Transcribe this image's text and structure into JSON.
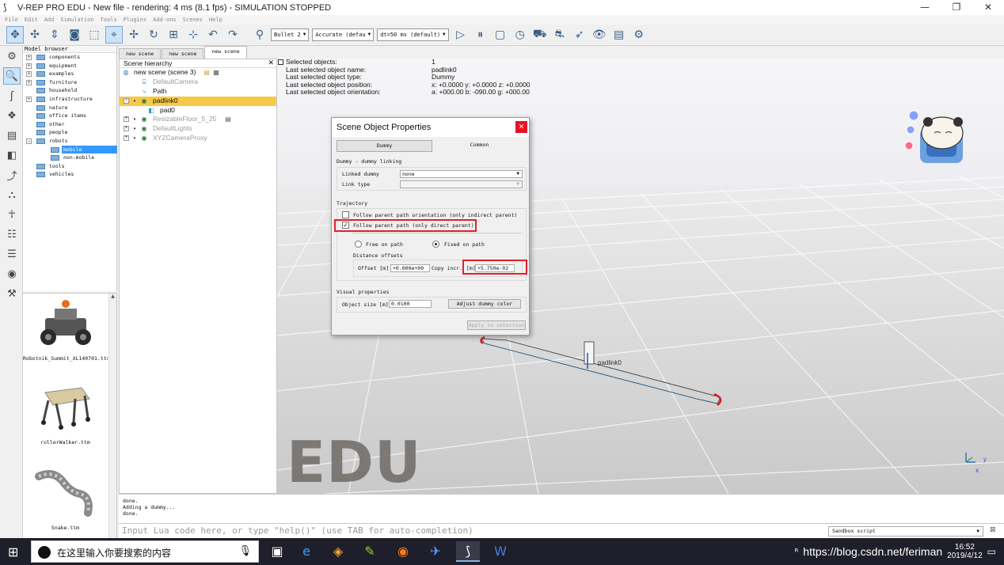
{
  "window": {
    "title": "V-REP PRO EDU - New file - rendering: 4 ms (8.1 fps) - SIMULATION STOPPED",
    "minimize": "—",
    "maximize": "❐",
    "close": "✕"
  },
  "menu": [
    "File",
    "Edit",
    "Add",
    "Simulation",
    "Tools",
    "Plugins",
    "Add-ons",
    "Scenes",
    "Help"
  ],
  "toolbar": {
    "engine": "Bullet 2",
    "accuracy": "Accurate (defau",
    "timestep": "dt=50 ms (default)"
  },
  "model_browser": {
    "header": "Model browser",
    "items": [
      {
        "label": "components",
        "expandable": true
      },
      {
        "label": "equipment",
        "expandable": true
      },
      {
        "label": "examples",
        "expandable": true
      },
      {
        "label": "furniture",
        "expandable": true
      },
      {
        "label": "household",
        "expandable": false
      },
      {
        "label": "infrastructure",
        "expandable": true
      },
      {
        "label": "nature",
        "expandable": false
      },
      {
        "label": "office items",
        "expandable": false
      },
      {
        "label": "other",
        "expandable": false
      },
      {
        "label": "people",
        "expandable": false
      },
      {
        "label": "robots",
        "expandable": true
      },
      {
        "label": "mobile",
        "expandable": false
      },
      {
        "label": "non-mobile",
        "expandable": false
      },
      {
        "label": "tools",
        "expandable": false
      },
      {
        "label": "vehicles",
        "expandable": false
      }
    ],
    "thumbnails": [
      {
        "caption": "Robotnik_Summit_XL140701.ttm"
      },
      {
        "caption": "rollerWalker.ttm"
      },
      {
        "caption": "Snake.ttm"
      }
    ]
  },
  "scene_tabs": [
    "new scene",
    "new scene",
    "new scene"
  ],
  "hierarchy": {
    "header": "Scene hierarchy",
    "items": [
      {
        "label": "new scene (scene 3)"
      },
      {
        "label": "DefaultCamera"
      },
      {
        "label": "Path"
      },
      {
        "label": "padlink0"
      },
      {
        "label": "pad0"
      },
      {
        "label": "ResizableFloor_5_25"
      },
      {
        "label": "DefaultLights"
      },
      {
        "label": "XYZCameraProxy"
      }
    ]
  },
  "selection_info": {
    "rows": [
      {
        "k": "Selected objects:",
        "v": "1"
      },
      {
        "k": "Last selected object name:",
        "v": "padlink0"
      },
      {
        "k": "Last selected object type:",
        "v": "Dummy"
      },
      {
        "k": "Last selected object position:",
        "v": "x: +0.0000   y: +0.0000   z: +0.0000"
      },
      {
        "k": "Last selected object orientation:",
        "v": "a: +000.00   b: -090.00   g: +000.00"
      }
    ]
  },
  "viewport": {
    "watermark": "EDU",
    "object_label": "padlink0",
    "axes_y": "y",
    "axes_x": "x"
  },
  "dialog": {
    "title": "Scene Object Properties",
    "close": "✕",
    "tabs": [
      "Dummy",
      "Common"
    ],
    "section_linking": "Dummy - dummy linking",
    "linked_dummy_label": "Linked dummy",
    "linked_dummy_value": "none",
    "link_type_label": "Link type",
    "link_type_value": "",
    "section_trajectory": "Trajectory",
    "follow_orientation": "Follow parent path orientation (only indirect parent)",
    "follow_path": "Follow parent path (only direct parent)",
    "follow_path_checked": "✓",
    "free_on_path": "Free on path",
    "fixed_on_path": "Fixed on path",
    "distance_offsets": "Distance offsets",
    "offset_label": "Offset [m]",
    "offset_value": "+0.000e+00",
    "copy_incr_label": "Copy incr.",
    "copy_incr_unit": "[m]",
    "copy_incr_value": "+5.750e-02",
    "section_visual": "Visual properties",
    "object_size_label": "Object size [m]",
    "object_size_value": "0.0100",
    "adjust_color": "Adjust dummy color",
    "apply_selection": "Apply to selection"
  },
  "console": {
    "lines": [
      "done.",
      "Adding a dummy...",
      "done."
    ],
    "input_placeholder": "Input Lua code here, or type \"help()\" (use TAB for auto-completion)",
    "script_mode": "Sandbox script"
  },
  "taskbar": {
    "search_placeholder": "在这里输入你要搜索的内容",
    "url_text": "https://blog.csdn.net/feriman",
    "time": "16:52",
    "date": "2019/4/12"
  },
  "colors": {
    "selection_highlight": "#f7c948",
    "tree_selection": "#3399ff",
    "annotation_red": "#e0202a",
    "dialog_close": "#e81123"
  }
}
